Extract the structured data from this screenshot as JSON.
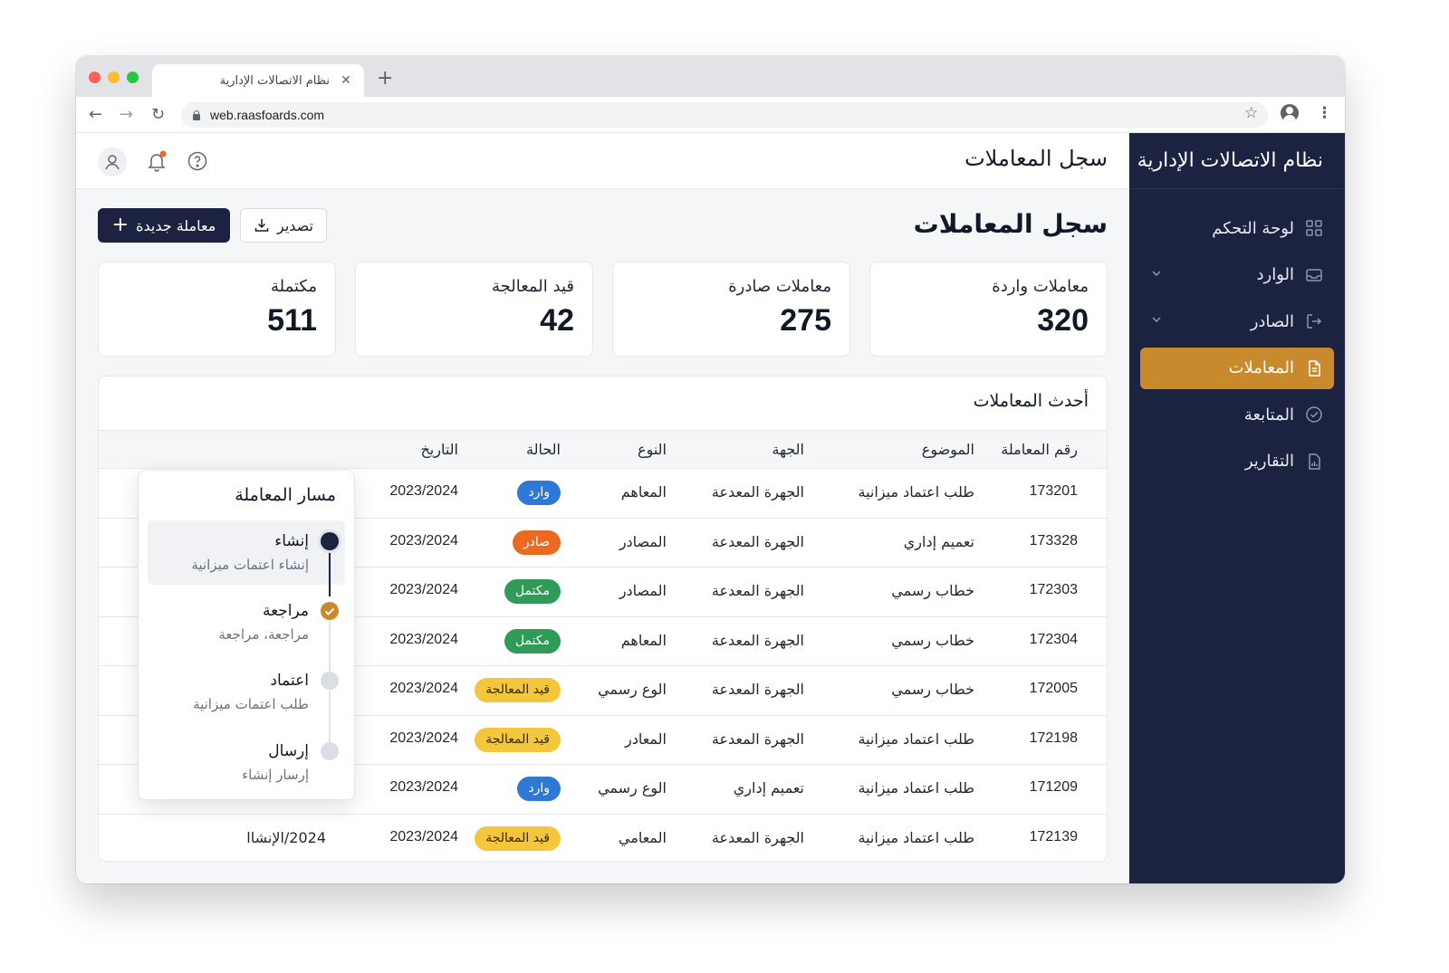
{
  "browser": {
    "tab_title": "نظام الاتصالات الإدارية",
    "url": "web.raasfoards.com"
  },
  "sidebar": {
    "brand": "نظام الاتصالات الإدارية",
    "items": [
      {
        "label": "لوحة التحكم",
        "icon": "grid-icon",
        "chevron": false,
        "active": false
      },
      {
        "label": "الوارد",
        "icon": "inbox-icon",
        "chevron": true,
        "active": false
      },
      {
        "label": "الصادر",
        "icon": "outbox-icon",
        "chevron": true,
        "active": false
      },
      {
        "label": "المعاملات",
        "icon": "document-icon",
        "chevron": false,
        "active": true
      },
      {
        "label": "المتابعة",
        "icon": "check-circle-icon",
        "chevron": false,
        "active": false
      },
      {
        "label": "التقارير",
        "icon": "report-icon",
        "chevron": false,
        "active": false
      }
    ]
  },
  "header": {
    "title": "سجل المعاملات"
  },
  "page": {
    "title": "سجل المعاملات",
    "new_button": "معاملة جديدة",
    "export_button": "تصدير"
  },
  "stats": [
    {
      "label": "معاملات واردة",
      "value": "320"
    },
    {
      "label": "معاملات صادرة",
      "value": "275"
    },
    {
      "label": "قيد المعالجة",
      "value": "42"
    },
    {
      "label": "مكتملة",
      "value": "511"
    }
  ],
  "table": {
    "title": "أحدث المعاملات",
    "columns": [
      "رقم المعاملة",
      "الموضوع",
      "الجهة",
      "النوع",
      "الحالة",
      "التاريخ"
    ],
    "rows": [
      {
        "num": "173201",
        "subject": "طلب اعتماد ميزانية",
        "org": "الجهرة المعدعة",
        "type": "المعاهم",
        "status": "وارد",
        "status_color": "blue",
        "date": "2023/2024",
        "extra": ""
      },
      {
        "num": "173328",
        "subject": "تعميم إداري",
        "org": "الجهرة المعدعة",
        "type": "المصادر",
        "status": "صادر",
        "status_color": "orange",
        "date": "2023/2024",
        "extra": ""
      },
      {
        "num": "172303",
        "subject": "خطاب رسمي",
        "org": "الجهرة المعدعة",
        "type": "المصادر",
        "status": "مكتمل",
        "status_color": "green",
        "date": "2023/2024",
        "extra": ""
      },
      {
        "num": "172304",
        "subject": "خطاب رسمي",
        "org": "الجهرة المعدعة",
        "type": "المعاهم",
        "status": "مكتمل",
        "status_color": "green",
        "date": "2023/2024",
        "extra": ""
      },
      {
        "num": "172005",
        "subject": "خطاب رسمي",
        "org": "الجهرة المعدعة",
        "type": "الوع رسمي",
        "status": "قيد المعالجة",
        "status_color": "yellow",
        "date": "2023/2024",
        "extra": ""
      },
      {
        "num": "172198",
        "subject": "طلب اعتماد ميزانية",
        "org": "الجهرة المعدعة",
        "type": "المعادر",
        "status": "قيد المعالجة",
        "status_color": "yellow",
        "date": "2023/2024",
        "extra": ""
      },
      {
        "num": "171209",
        "subject": "طلب اعتماد ميزانية",
        "org": "تعميم إداري",
        "type": "الوع رسمي",
        "status": "وارد",
        "status_color": "blue",
        "date": "2023/2024",
        "extra": ""
      },
      {
        "num": "172139",
        "subject": "طلب اعتماد ميزانية",
        "org": "الجهرة المعدعة",
        "type": "المعامي",
        "status": "قيد المعالجة",
        "status_color": "yellow",
        "date": "2023/2024",
        "extra": "2024/الإنشاا"
      }
    ]
  },
  "popover": {
    "title": "مسار المعاملة",
    "steps": [
      {
        "label": "إنشاء",
        "sub": "إنشاء اعتمات ميزانية",
        "state": "current"
      },
      {
        "label": "مراجعة",
        "sub": "مراجعة، مراجعة",
        "state": "done"
      },
      {
        "label": "اعتماد",
        "sub": "طلب اعتمات ميزانية",
        "state": "pending"
      },
      {
        "label": "إرسال",
        "sub": "إرسار إنشاء",
        "state": "pending"
      }
    ]
  },
  "colors": {
    "sidebar_bg": "#1b2340",
    "accent": "#c9892d",
    "badge_blue": "#2f79d6",
    "badge_orange": "#ea6a1f",
    "badge_green": "#2f9b56",
    "badge_yellow": "#f4c63c"
  }
}
